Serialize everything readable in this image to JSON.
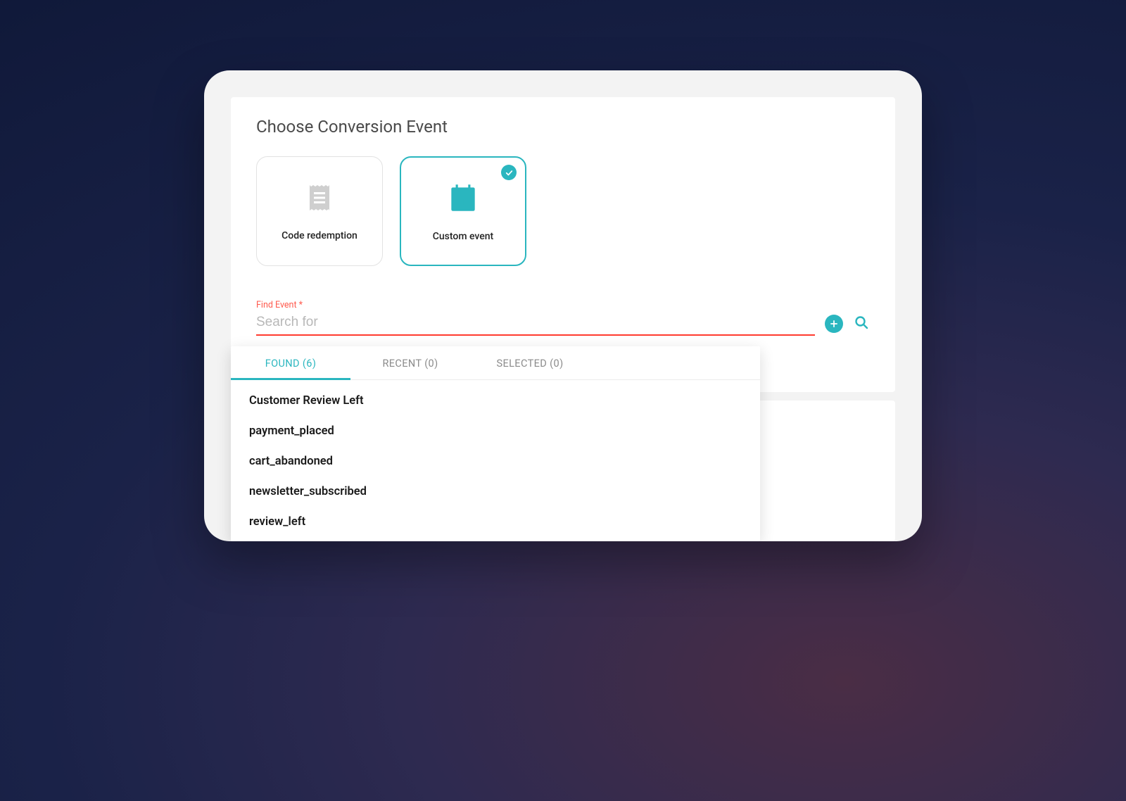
{
  "header": {
    "title": "Choose Conversion Event"
  },
  "tiles": {
    "code_redemption": {
      "label": "Code redemption"
    },
    "custom_event": {
      "label": "Custom event"
    }
  },
  "search": {
    "label": "Find Event *",
    "placeholder": "Search for"
  },
  "tabs": {
    "found": {
      "label": "FOUND (6)"
    },
    "recent": {
      "label": "RECENT (0)"
    },
    "selected": {
      "label": "SELECTED (0)"
    }
  },
  "results": [
    "Customer Review Left",
    "payment_placed",
    "cart_abandoned",
    "newsletter_subscribed",
    "review_left"
  ],
  "colors": {
    "accent": "#2ab6bf",
    "error": "#ff3b2f"
  }
}
